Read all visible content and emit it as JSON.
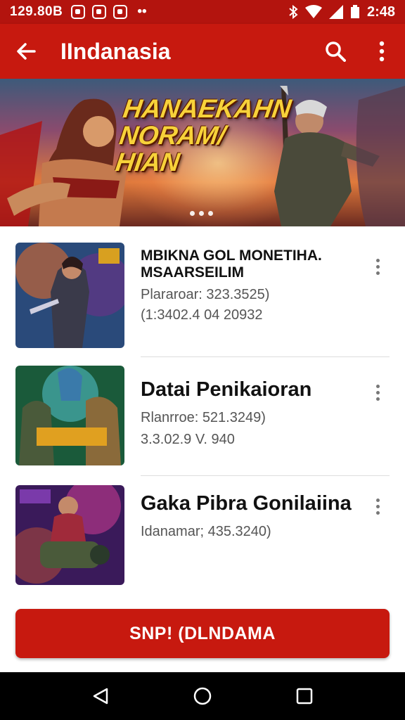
{
  "status_bar": {
    "left_text": "129.80B",
    "dots": "••",
    "clock": "2:48"
  },
  "app_bar": {
    "title": "IIndanasia",
    "icons": [
      "arrow-back-icon",
      "search-icon",
      "more-vert-icon"
    ]
  },
  "banner": {
    "headline_line1": "HANAEKAHN",
    "headline_line2": "NORAM/ HIAN",
    "page_count": 3
  },
  "items": [
    {
      "title_line1": "MBIKNA GOL MONETIHA.",
      "title_line2": "MSAARSEILIM",
      "meta1": "Plararoar: 323.3525)",
      "meta2": "(1:3402.4 04 20932"
    },
    {
      "title_line1": "Datai Penikaioran",
      "meta1": "Rlanrroe: 521.3249)",
      "meta2": "3.3.02.9 V. 940"
    },
    {
      "title_line1": "Gaka Pibra Gonilaiina",
      "meta1": "Idanamar; 435.3240)"
    }
  ],
  "cta": {
    "label": "SNP! (DLNDAMA"
  },
  "colors": {
    "brand": "#c7190f",
    "status": "#b3140e"
  }
}
